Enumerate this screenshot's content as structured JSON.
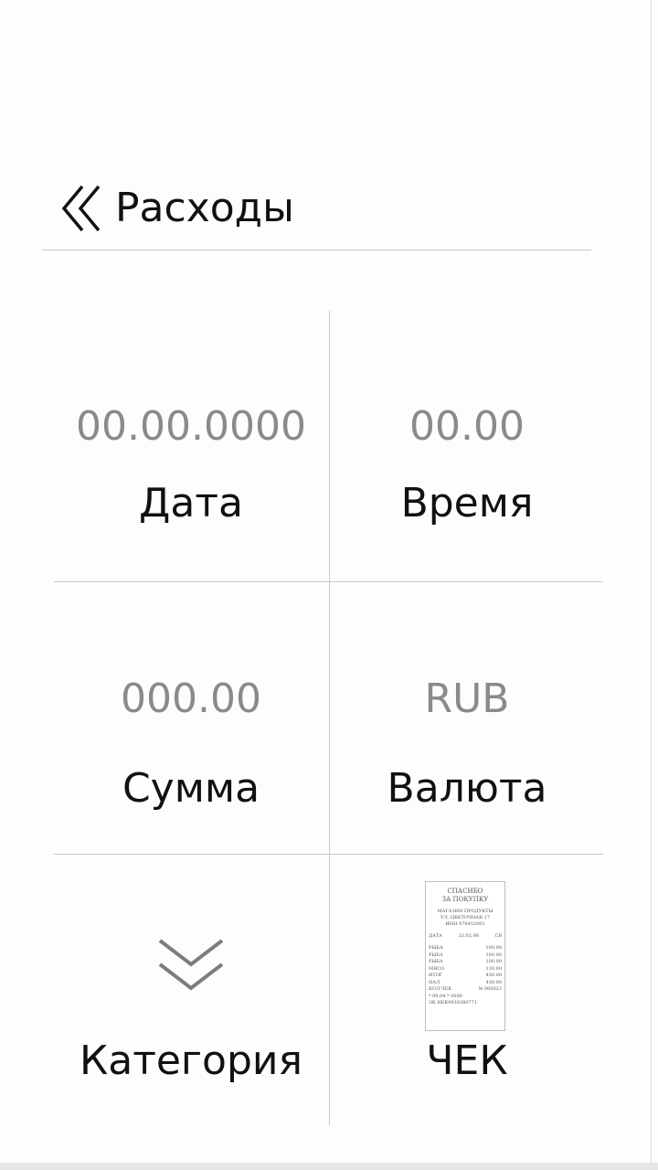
{
  "header": {
    "title": "Расходы",
    "back_icon": "double-chevron-left-icon"
  },
  "fields": {
    "date": {
      "value": "00.00.0000",
      "label": "Дата"
    },
    "time": {
      "value": "00.00",
      "label": "Время"
    },
    "amount": {
      "value": "000.00",
      "label": "Сумма"
    },
    "currency": {
      "value": "RUB",
      "label": "Валюта"
    },
    "category": {
      "label": "Категория",
      "icon": "double-chevron-down-icon"
    },
    "receipt": {
      "label": "ЧЕК",
      "icon": "receipt-thumbnail"
    }
  },
  "receipt_thumbnail": {
    "heading": [
      "СПАСИБО",
      "ЗА ПОКУПКУ"
    ],
    "shop": [
      "МАГАЗИН ПРОДУКТЫ",
      "УЛ. ЦВЕТОЧНАЯ 17",
      "ИНН 976452001"
    ],
    "date_label": "ДАТА",
    "date_value": "23.02.98",
    "date_suffix": "СВ",
    "items": [
      {
        "name": "РЫБА",
        "price": "100.00"
      },
      {
        "name": "РЫБА",
        "price": "100.00"
      },
      {
        "name": "РЫБА",
        "price": "100.00"
      },
      {
        "name": "МЯСО",
        "price": "130.00"
      },
      {
        "name": "ИТОГ",
        "price": "430.00"
      },
      {
        "name": "НАЛ",
        "price": "430.00"
      },
      {
        "name": "КОЛ.ЧЕК",
        "price": "№ 000023"
      }
    ],
    "footer": [
      "* 09.04 *          0000",
      "ЭК          НЕК9930380771"
    ]
  },
  "colors": {
    "background": "#fdfdfd",
    "text": "#111111",
    "placeholder": "#8a8a8a",
    "divider": "#c8c8c8"
  }
}
